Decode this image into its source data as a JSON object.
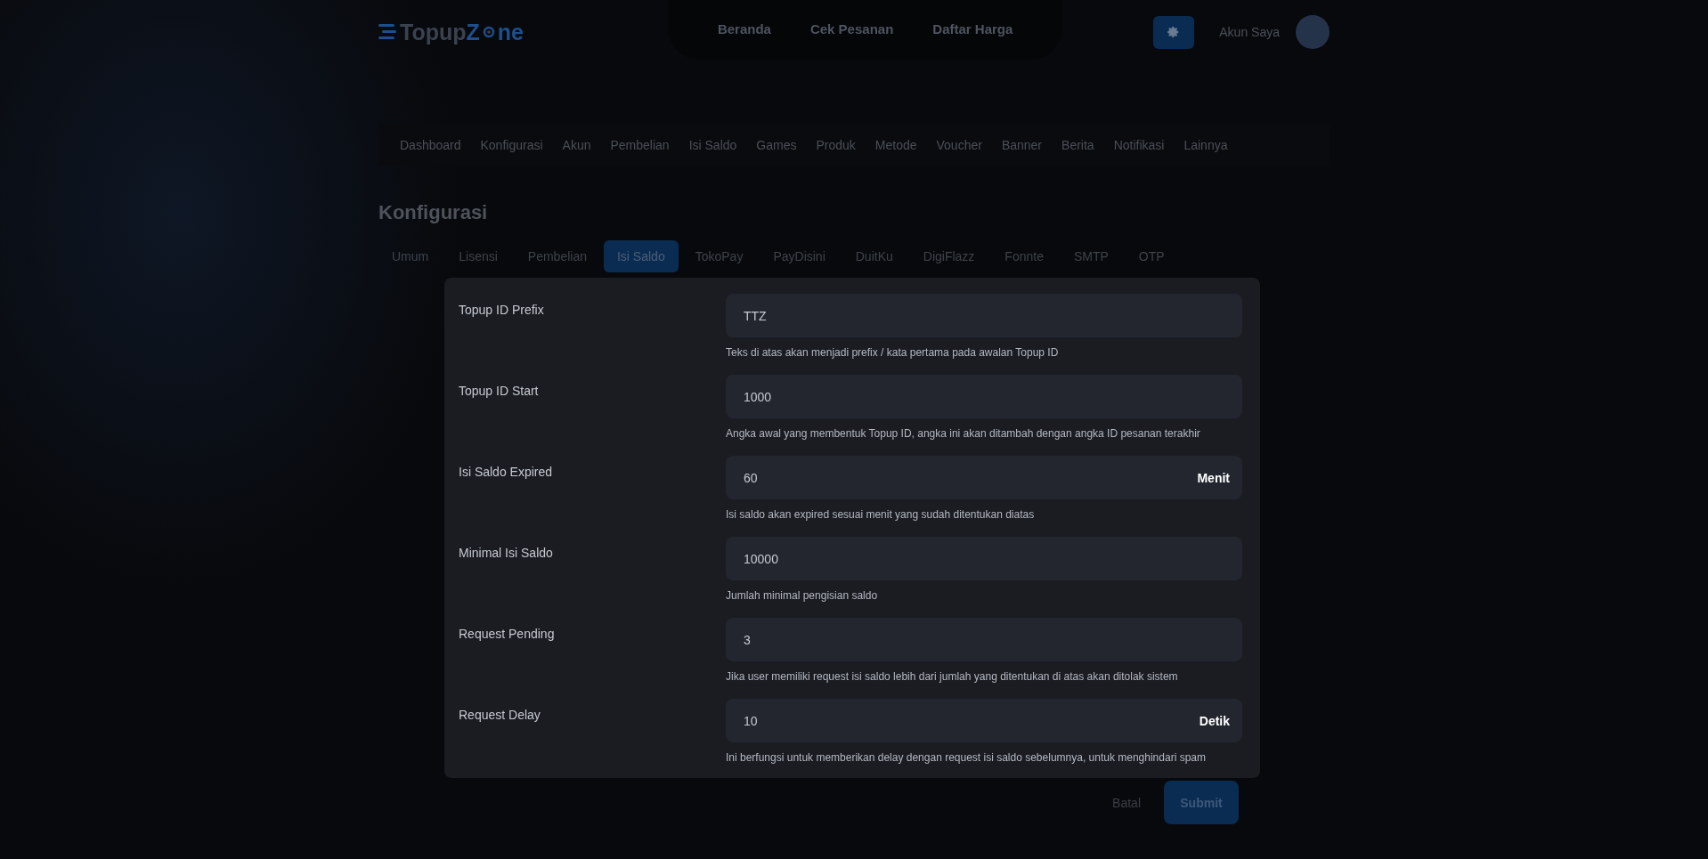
{
  "header": {
    "logo": {
      "part_1": "Topup",
      "part_2": "Z",
      "part_3": "ne"
    },
    "nav": [
      "Beranda",
      "Cek Pesanan",
      "Daftar Harga"
    ],
    "account": "Akun Saya"
  },
  "menu": [
    "Dashboard",
    "Konfigurasi",
    "Akun",
    "Pembelian",
    "Isi Saldo",
    "Games",
    "Produk",
    "Metode",
    "Voucher",
    "Banner",
    "Berita",
    "Notifikasi",
    "Lainnya"
  ],
  "page_title": "Konfigurasi",
  "tabs": [
    {
      "label": "Umum",
      "selected": false
    },
    {
      "label": "Lisensi",
      "selected": false
    },
    {
      "label": "Pembelian",
      "selected": false
    },
    {
      "label": "Isi Saldo",
      "selected": true
    },
    {
      "label": "TokoPay",
      "selected": false
    },
    {
      "label": "PayDisini",
      "selected": false
    },
    {
      "label": "DuitKu",
      "selected": false
    },
    {
      "label": "DigiFlazz",
      "selected": false
    },
    {
      "label": "Fonnte",
      "selected": false
    },
    {
      "label": "SMTP",
      "selected": false
    },
    {
      "label": "OTP",
      "selected": false
    }
  ],
  "fields": [
    {
      "label": "Topup ID Prefix",
      "value": "TTZ",
      "help": "Teks di atas akan menjadi prefix / kata pertama pada awalan Topup ID"
    },
    {
      "label": "Topup ID Start",
      "value": "1000",
      "help": "Angka awal yang membentuk Topup ID, angka ini akan ditambah dengan angka ID pesanan terakhir"
    },
    {
      "label": "Isi Saldo Expired",
      "value": "60",
      "suffix": "Menit",
      "help": "Isi saldo akan expired sesuai menit yang sudah ditentukan diatas"
    },
    {
      "label": "Minimal Isi Saldo",
      "value": "10000",
      "help": "Jumlah minimal pengisian saldo"
    },
    {
      "label": "Request Pending",
      "value": "3",
      "help": "Jika user memiliki request isi saldo lebih dari jumlah yang ditentukan di atas akan ditolak sistem"
    },
    {
      "label": "Request Delay",
      "value": "10",
      "suffix": "Detik",
      "help": "Ini berfungsi untuk memberikan delay dengan request isi saldo sebelumnya, untuk menghindari spam"
    }
  ],
  "buttons": {
    "cancel": "Batal",
    "submit": "Submit"
  }
}
